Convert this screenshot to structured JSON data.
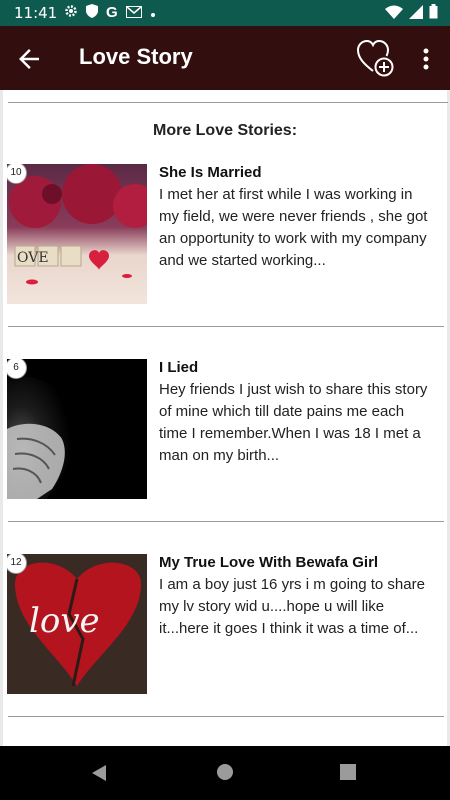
{
  "status_bar": {
    "time": "11:41",
    "google_letter": "G"
  },
  "app_bar": {
    "title": "Love Story"
  },
  "section": {
    "title": "More Love Stories:"
  },
  "stories": [
    {
      "badge": "10",
      "title": "She Is Married",
      "snippet": "I met her at first while I was working in my field, we were never friends , she got an opportunity to work with my company and we started working...",
      "image_text": "OVE"
    },
    {
      "badge": "6",
      "title": "I Lied",
      "snippet": "Hey friends I just wish to share this story of mine which till date pains me each time I remember.When I was 18 I met a man on my birth..."
    },
    {
      "badge": "12",
      "title": "My True Love With Bewafa Girl",
      "snippet": "I am a boy just 16 yrs i m going to share my lv story wid u....hope u will like it...here it goes I think it was a time of...",
      "image_text": "love"
    }
  ],
  "icons": {
    "back": "arrow-back-icon",
    "add_favorite": "heart-plus-icon",
    "more": "more-vert-icon"
  },
  "colors": {
    "status_bar": "#0f5a4f",
    "app_bar": "#330e0e",
    "nav_bar": "#000000"
  }
}
